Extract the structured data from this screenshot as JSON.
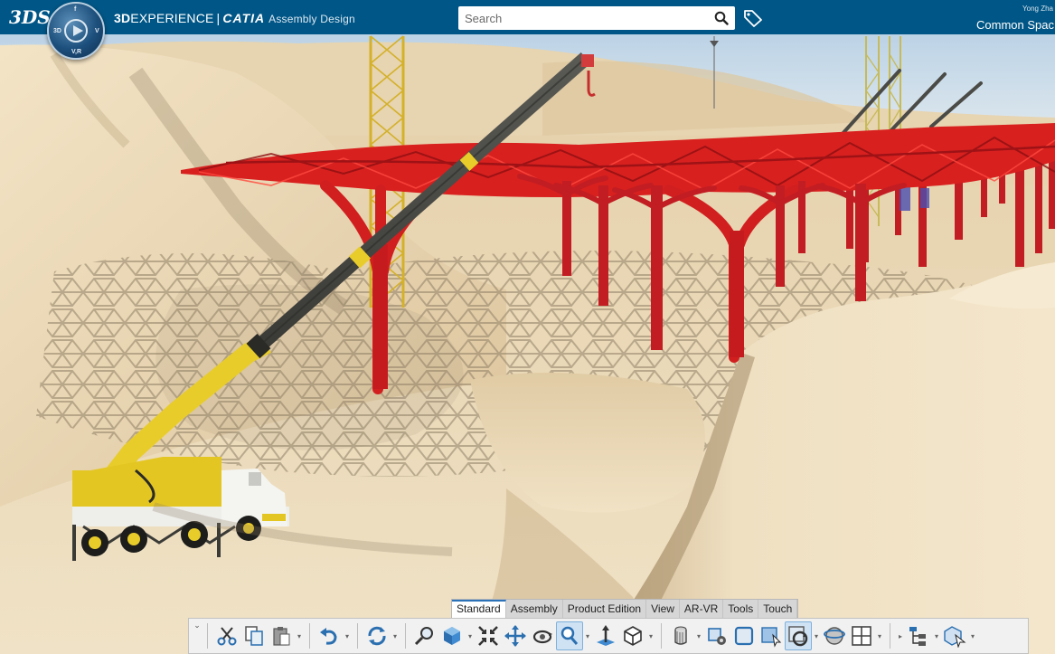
{
  "header": {
    "brand_logo": "3DS",
    "brand_bold": "3D",
    "brand_rest": "EXPERIENCE",
    "separator": "|",
    "app_name": "CATIA",
    "app_module": "Assembly Design",
    "compass": {
      "top": "f",
      "left": "3D",
      "right": "V",
      "bottom": "V,R"
    },
    "search_placeholder": "Search",
    "user_name": "Yong Zha",
    "collab_space": "Common Spac"
  },
  "section_tabs": [
    {
      "label": "Standard",
      "active": true
    },
    {
      "label": "Assembly",
      "active": false
    },
    {
      "label": "Product Edition",
      "active": false
    },
    {
      "label": "View",
      "active": false
    },
    {
      "label": "AR-VR",
      "active": false
    },
    {
      "label": "Tools",
      "active": false
    },
    {
      "label": "Touch",
      "active": false
    }
  ],
  "action_bar": {
    "expand_glyph": "⌄",
    "tools": [
      "cut-icon",
      "copy-icon",
      "paste-icon",
      "undo-icon",
      "update-icon",
      "zoom-area-icon",
      "view-cube-icon",
      "fit-all-icon",
      "pan-icon",
      "rotate-icon",
      "zoom-icon",
      "normal-view-icon",
      "isometric-view-icon",
      "shading-icon",
      "render-icon",
      "hide-show-icon",
      "viewpoint-icon",
      "ambient-icon",
      "render-style-icon",
      "layout-icon",
      "tree-icon",
      "select-icon"
    ]
  },
  "colors": {
    "topbar": "#005686",
    "steel": "#d61f1f",
    "crane": "#e8cc2a",
    "sand": "#e9d7b3",
    "sky": "#c9dceb",
    "toolbar_bg": "#f1f1f1",
    "tab_accent": "#2b72b8"
  }
}
